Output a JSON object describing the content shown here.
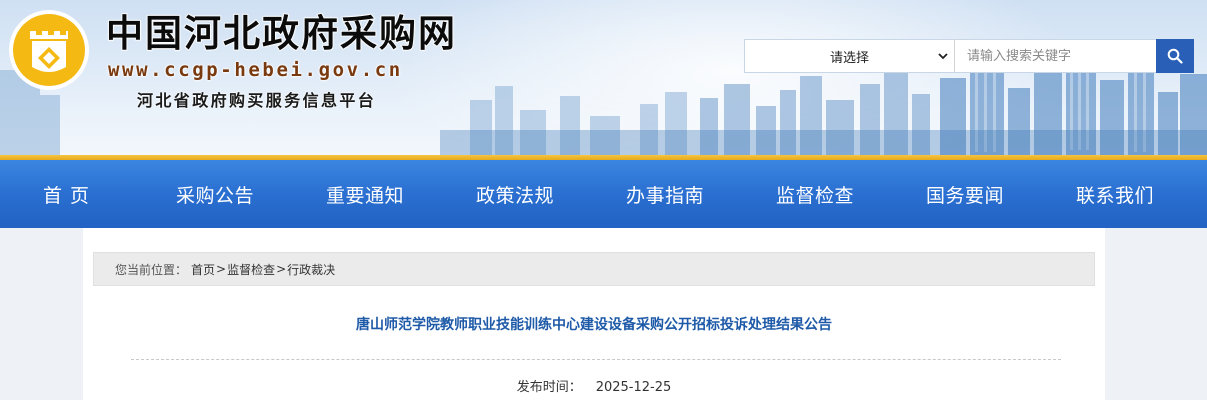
{
  "header": {
    "title": "中国河北政府采购网",
    "url": "www.ccgp-hebei.gov.cn",
    "subtitle": "河北省政府购买服务信息平台"
  },
  "search": {
    "select_value": "请选择",
    "placeholder": "请输入搜索关键字"
  },
  "nav": {
    "items": [
      {
        "label": "首页"
      },
      {
        "label": "采购公告"
      },
      {
        "label": "重要通知"
      },
      {
        "label": "政策法规"
      },
      {
        "label": "办事指南"
      },
      {
        "label": "监督检查"
      },
      {
        "label": "国务要闻"
      },
      {
        "label": "联系我们"
      }
    ]
  },
  "breadcrumb": {
    "label": "您当前位置：",
    "items": [
      "首页",
      "监督检查",
      "行政裁决"
    ],
    "separator": ">"
  },
  "article": {
    "title": "唐山师范学院教师职业技能训练中心建设设备采购公开招标投诉处理结果公告",
    "date_label": "发布时间：",
    "date_value": "2025-12-25"
  },
  "colors": {
    "nav_blue": "#2a6fd1",
    "gold": "#e7a91b",
    "title_blue": "#1e5aa8",
    "search_button": "#2a5fb8"
  }
}
